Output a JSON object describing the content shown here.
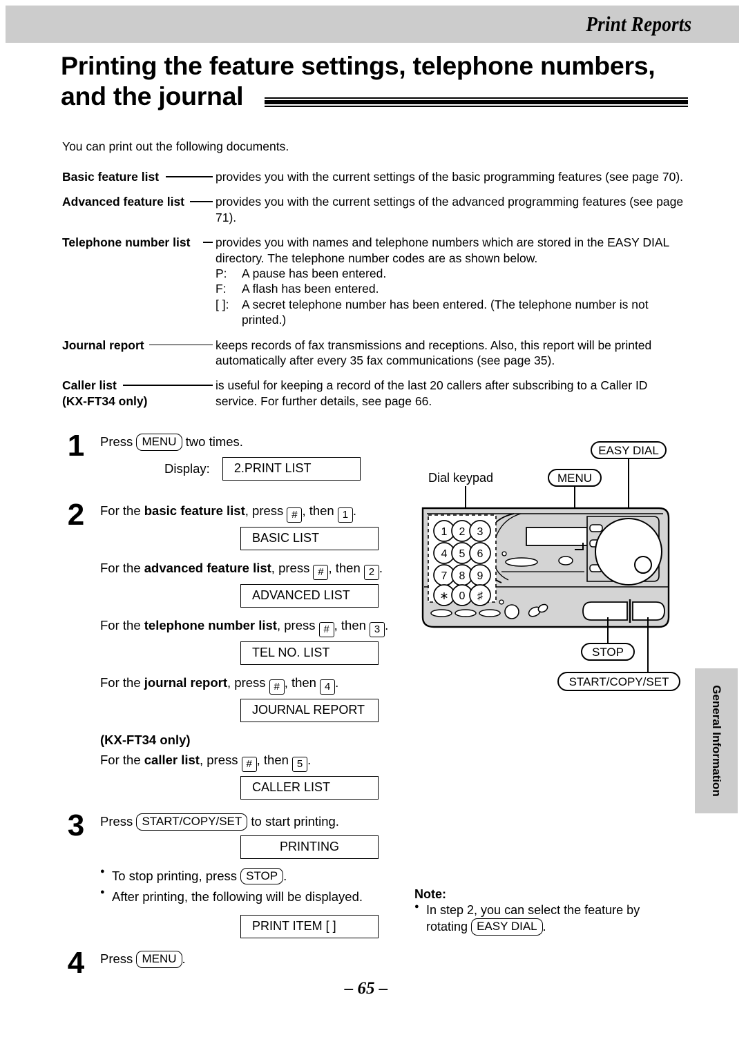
{
  "header": {
    "running_title": "Print Reports"
  },
  "title": {
    "text": "Printing the feature settings, telephone numbers, and the journal"
  },
  "intro": {
    "text": "You can print out the following documents."
  },
  "definitions": [
    {
      "term": "Basic feature list",
      "desc": "provides you with the current settings of the basic programming features (see page 70)."
    },
    {
      "term": "Advanced feature list",
      "desc": "provides you with the current settings of the advanced programming features (see page 71)."
    },
    {
      "term": "Telephone number list",
      "desc": "provides you with names and telephone numbers which are stored in the EASY DIAL directory. The telephone number codes are as shown below.",
      "codes": [
        {
          "key": "P:",
          "value": "A pause has been entered."
        },
        {
          "key": "F:",
          "value": "A flash has been entered."
        },
        {
          "key": "[  ]:",
          "value": "A secret telephone number has been entered. (The telephone number is not printed.)"
        }
      ]
    },
    {
      "term": "Journal report",
      "desc": "keeps records of fax transmissions and receptions. Also, this report will be printed automatically after every 35 fax communications (see page 35)."
    },
    {
      "term": "Caller list",
      "term_sub": "(KX-FT34 only)",
      "desc": "is useful for keeping a record of the last 20 callers after subscribing to a Caller ID service. For further details, see page 66."
    }
  ],
  "steps": {
    "s1": {
      "num": "1",
      "press_word": "Press",
      "key": "MENU",
      "tail": "two times.",
      "display_label": "Display:",
      "lcd": "2.PRINT LIST"
    },
    "s2": {
      "num": "2",
      "lines": [
        {
          "pre": "For the",
          "bold": "basic feature list",
          "mid": ", press",
          "key1": "#",
          "mid2": ", then",
          "key2": "1",
          "end": ".",
          "lcd": "BASIC LIST"
        },
        {
          "pre": "For the",
          "bold": "advanced feature list",
          "mid": ", press",
          "key1": "#",
          "mid2": ", then",
          "key2": "2",
          "end": ".",
          "lcd": "ADVANCED LIST"
        },
        {
          "pre": "For the",
          "bold": "telephone number list",
          "mid": ", press",
          "key1": "#",
          "mid2": ", then",
          "key2": "3",
          "end": ".",
          "lcd": "TEL NO. LIST"
        },
        {
          "pre": "For the",
          "bold": "journal report",
          "mid": ", press",
          "key1": "#",
          "mid2": ", then",
          "key2": "4",
          "end": ".",
          "lcd": "JOURNAL REPORT"
        }
      ],
      "only_label": "(KX-FT34 only)",
      "caller_line": {
        "pre": "For the",
        "bold": "caller list",
        "mid": ", press",
        "key1": "#",
        "mid2": ", then",
        "key2": "5",
        "end": ".",
        "lcd": "CALLER LIST"
      }
    },
    "s3": {
      "num": "3",
      "press_word": "Press",
      "key": "START/COPY/SET",
      "tail": "to start printing.",
      "lcd": "PRINTING",
      "bullet1_pre": "To stop printing, press",
      "bullet1_key": "STOP",
      "bullet1_end": ".",
      "bullet2": "After printing, the following will be displayed.",
      "lcd2": "PRINT ITEM   [ ]"
    },
    "s4": {
      "num": "4",
      "press_word": "Press",
      "key": "MENU",
      "tail": "."
    }
  },
  "illustration": {
    "dial_keypad_label": "Dial keypad",
    "callouts": {
      "easy_dial": "EASY DIAL",
      "menu": "MENU",
      "stop": "STOP",
      "start_copy_set": "START/COPY/SET"
    },
    "keypad_keys": [
      "1",
      "2",
      "3",
      "4",
      "5",
      "6",
      "7",
      "8",
      "9",
      "∗",
      "0",
      "♯"
    ]
  },
  "note": {
    "heading": "Note:",
    "body_pre": "In step 2, you can select the feature by rotating",
    "body_key": "EASY DIAL",
    "body_end": "."
  },
  "side_tab": {
    "label": "General Information"
  },
  "folio": {
    "text": "– 65 –"
  },
  "colors": {
    "header_gray": "#cccccc",
    "ink": "#000000",
    "machine_body": "#d4d4d4"
  }
}
